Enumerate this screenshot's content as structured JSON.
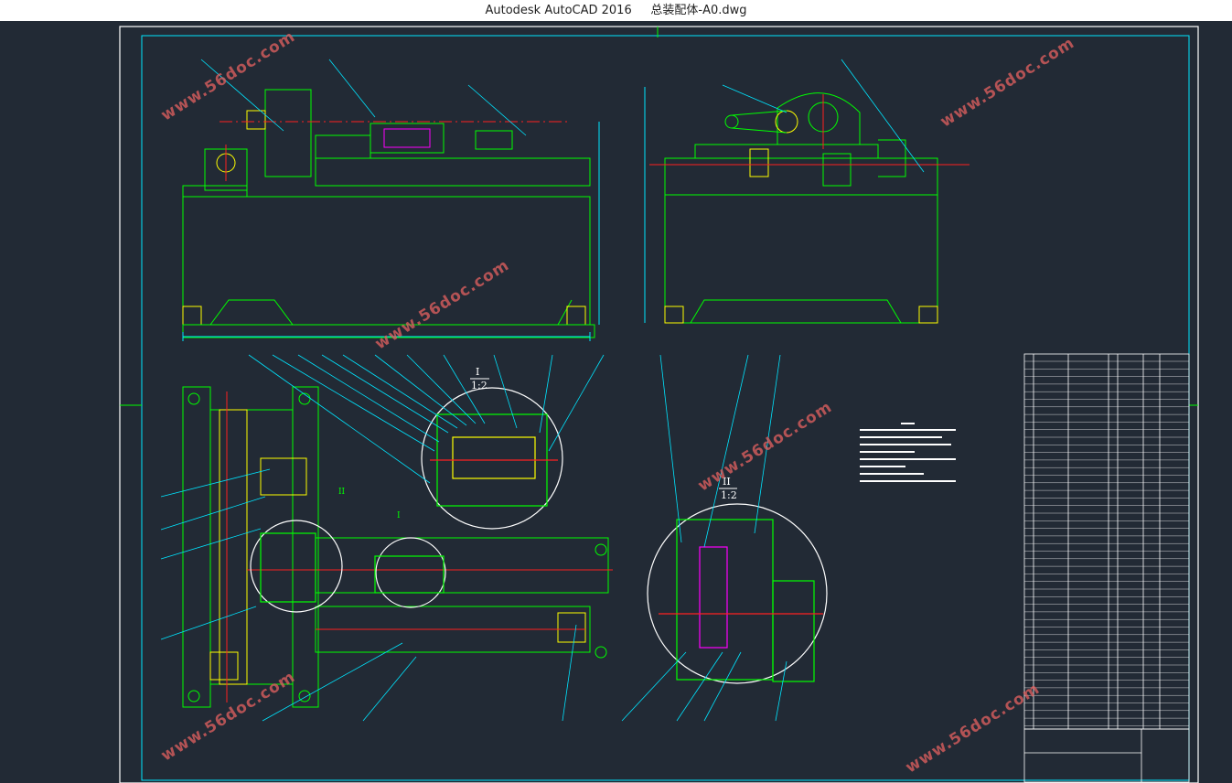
{
  "window": {
    "title_app": "Autodesk AutoCAD 2016",
    "title_file": "总装配体-A0.dwg"
  },
  "drawing": {
    "detail_I_label": "I",
    "detail_I_scale": "1:2",
    "detail_II_label": "II",
    "detail_II_scale": "1:2",
    "leader_label_I": "I",
    "leader_label_II": "II"
  },
  "watermarks": {
    "text": "www.56doc.com"
  },
  "colors": {
    "background": "#222a35",
    "frame": "#ffffff",
    "outline": "#00ff00",
    "dimension": "#00e5ff",
    "centerline": "#ff2020",
    "yellow": "#ffff00",
    "magenta": "#ff00ff",
    "watermark": "#de5f5f"
  }
}
